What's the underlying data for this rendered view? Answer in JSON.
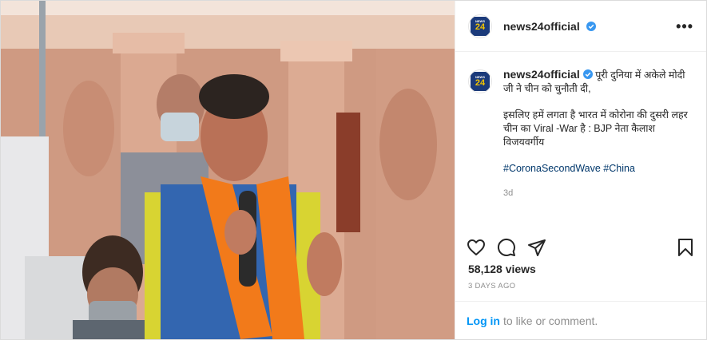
{
  "account": {
    "username": "news24official",
    "logo_top": "NEWS",
    "logo_num": "24",
    "more_label": "•••"
  },
  "caption": {
    "username": "news24official",
    "line1": "पूरी दुनिया में अकेले मोदी जी ने चीन को चुनौती दी,",
    "line2": "इसलिए हमें लगता है भारत में कोरोना की दुसरी लहर चीन का Viral -War है : BJP नेता कैलाश विजयवर्गीय",
    "hashtags": "#CoronaSecondWave #China",
    "age": "3d"
  },
  "stats": {
    "views": "58,128 views",
    "date": "3 DAYS AGO"
  },
  "footer": {
    "login_label": "Log in",
    "rest_text": "to like or comment."
  },
  "icons": [
    "heart-icon",
    "comment-icon",
    "share-icon",
    "bookmark-icon",
    "verified-badge-icon",
    "more-options-icon"
  ],
  "colors": {
    "link_blue": "#0095f6",
    "hashtag_blue": "#00376b",
    "muted": "#8e8e8e",
    "verified": "#3897f0"
  }
}
